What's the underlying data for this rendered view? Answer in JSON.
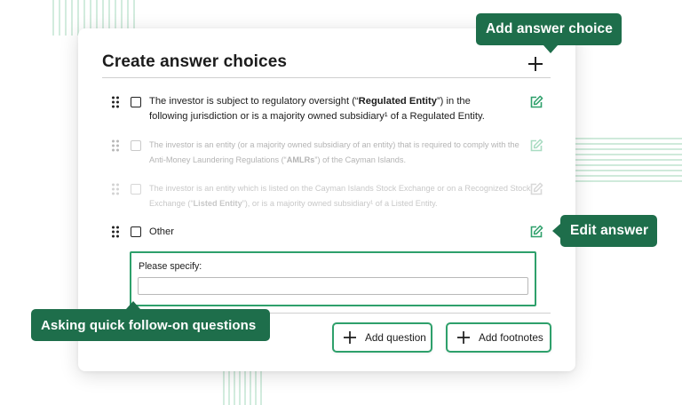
{
  "card": {
    "title": "Create answer choices",
    "choices": [
      {
        "pre": "The investor is subject to regulatory oversight (“",
        "bold": "Regulated Entity",
        "post": "”) in the following jurisdiction or is a majority owned subsidiary¹ of a Regulated Entity.",
        "state": "active"
      },
      {
        "pre": "The investor is an entity (or a majority owned subsidiary of an entity) that is required to comply with the Anti-Money Laundering Regulations (“",
        "bold": "AMLRs",
        "post": "”) of the Cayman Islands.",
        "state": "faded"
      },
      {
        "pre": "The investor is an entity which is listed on the Cayman Islands Stock Exchange or on a Recognized Stock Exchange (“",
        "bold": "Listed Entity",
        "post": "”), or is a majority owned subsidiary¹ of a Listed Entity.",
        "state": "faded"
      },
      {
        "pre": "Other",
        "bold": "",
        "post": "",
        "state": "active"
      }
    ],
    "specify": {
      "label": "Please specify:",
      "value": "",
      "placeholder": ""
    },
    "buttons": {
      "add_question": "Add question",
      "add_footnotes": "Add footnotes"
    }
  },
  "callouts": {
    "add_answer_choice": "Add answer choice",
    "edit_answer": "Edit answer",
    "asking_follow_on": "Asking quick follow-on questions"
  },
  "colors": {
    "accent_green": "#2ea06b",
    "callout_green": "#1e6e4b",
    "deco_green": "#bfe3cf",
    "faded_text": "#b4b4b4"
  },
  "icons": {
    "add": "plus-icon",
    "edit": "edit-icon",
    "drag": "drag-handle-icon",
    "checkbox": "checkbox-icon"
  }
}
